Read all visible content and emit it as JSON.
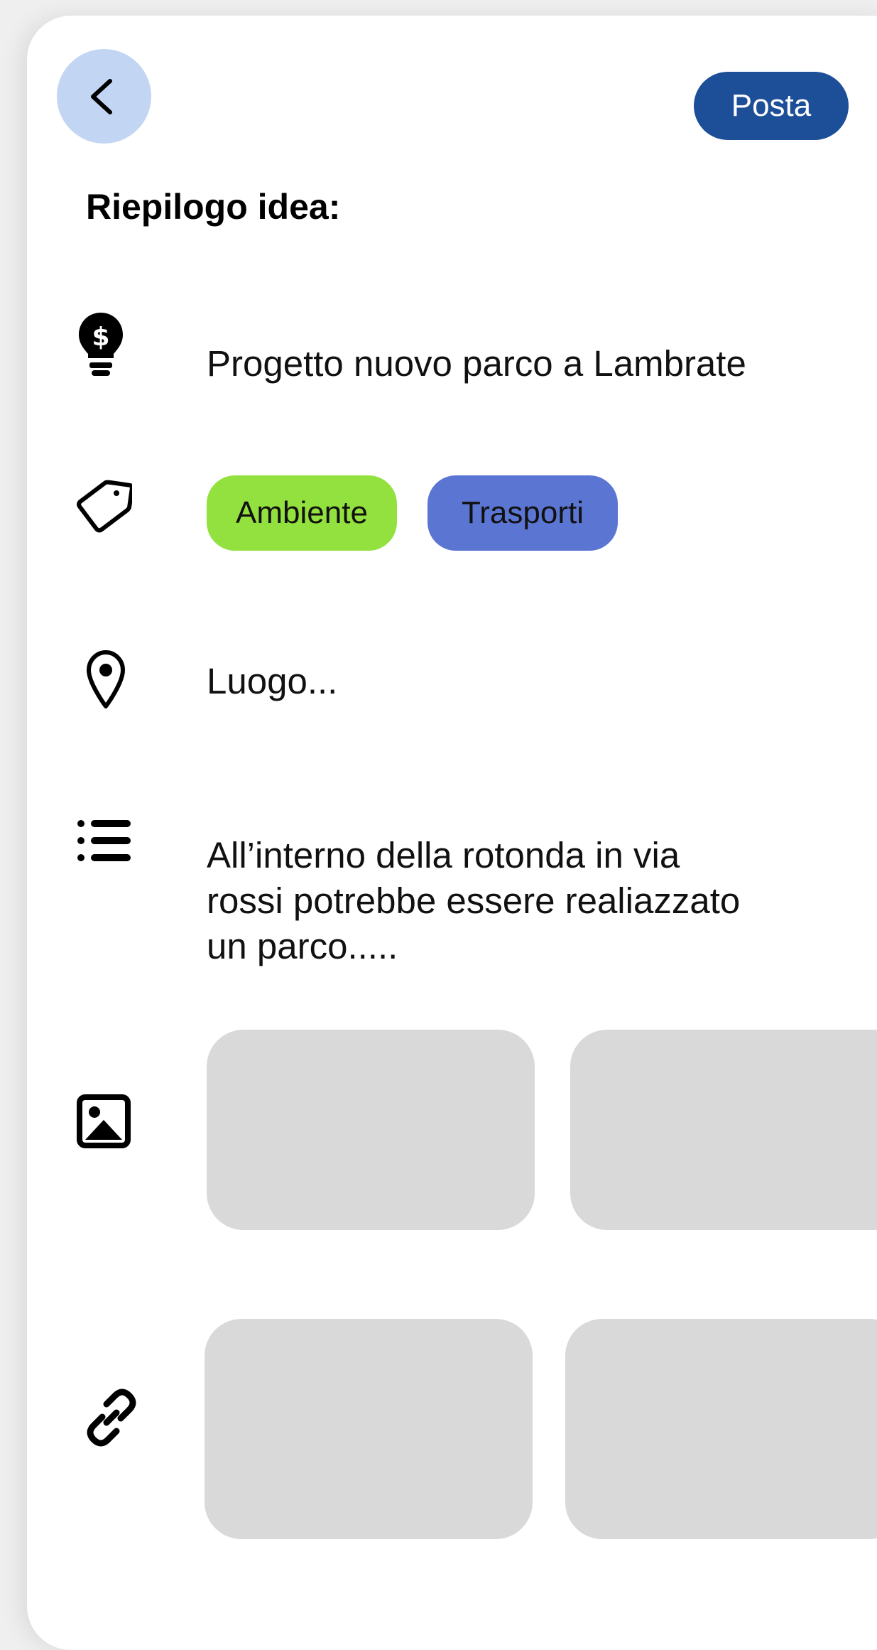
{
  "header": {
    "back_icon": "chevron-left-icon",
    "post_label": "Posta"
  },
  "summary_title": "Riepilogo idea:",
  "idea": {
    "icon": "lightbulb-dollar-icon",
    "title": "Progetto nuovo parco a Lambrate"
  },
  "tags": {
    "icon": "tag-icon",
    "items": [
      {
        "label": "Ambiente",
        "color": "#93e13f"
      },
      {
        "label": "Trasporti",
        "color": "#5b75d3"
      }
    ]
  },
  "location": {
    "icon": "map-pin-icon",
    "placeholder": "Luogo..."
  },
  "description": {
    "icon": "list-icon",
    "lines": [
      "All’interno della rotonda in via",
      "rossi potrebbe essere realiazzato",
      "un parco....."
    ]
  },
  "images": {
    "icon": "image-icon"
  },
  "links": {
    "icon": "link-icon"
  },
  "colors": {
    "accent": "#1d4f99",
    "back_button": "#c2d6f3",
    "placeholder": "#d9d9d9"
  }
}
